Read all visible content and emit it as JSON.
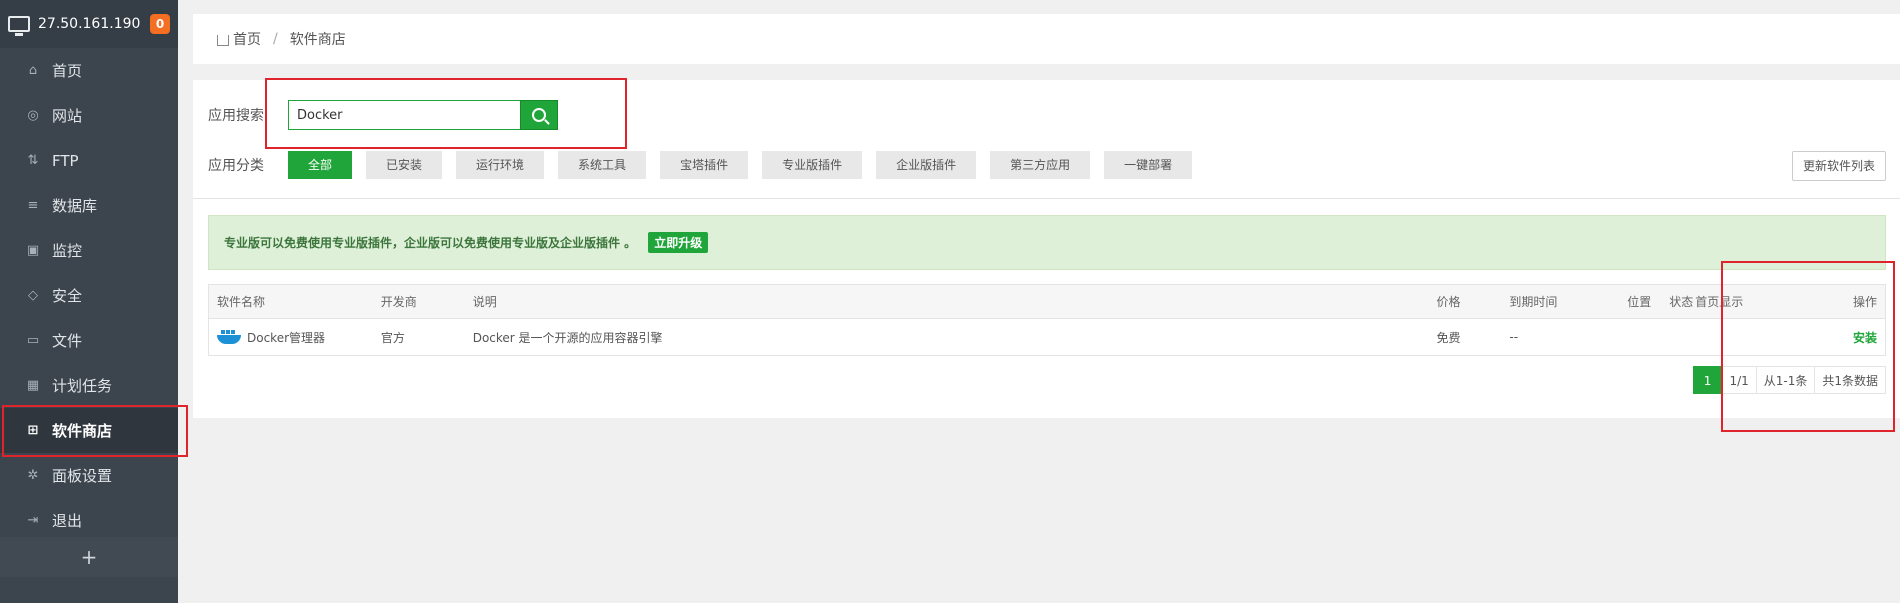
{
  "sidebar": {
    "server_ip": "27.50.161.190",
    "badge_count": "0",
    "items": [
      {
        "label": "首页",
        "icon": "home-icon"
      },
      {
        "label": "网站",
        "icon": "globe-icon"
      },
      {
        "label": "FTP",
        "icon": "ftp-icon"
      },
      {
        "label": "数据库",
        "icon": "database-icon"
      },
      {
        "label": "监控",
        "icon": "monitor-icon"
      },
      {
        "label": "安全",
        "icon": "shield-icon"
      },
      {
        "label": "文件",
        "icon": "folder-icon"
      },
      {
        "label": "计划任务",
        "icon": "calendar-icon"
      },
      {
        "label": "软件商店",
        "icon": "grid-icon"
      },
      {
        "label": "面板设置",
        "icon": "gear-icon"
      },
      {
        "label": "退出",
        "icon": "logout-icon"
      }
    ],
    "add_label": "+"
  },
  "breadcrumb": {
    "home": "首页",
    "separator": "/",
    "current": "软件商店"
  },
  "search": {
    "label": "应用搜索",
    "value": "Docker"
  },
  "categories": {
    "label": "应用分类",
    "items": [
      "全部",
      "已安装",
      "运行环境",
      "系统工具",
      "宝塔插件",
      "专业版插件",
      "企业版插件",
      "第三方应用",
      "一键部署"
    ]
  },
  "refresh_label": "更新软件列表",
  "notice": {
    "text": "专业版可以免费使用专业版插件，企业版可以免费使用专业版及企业版插件 。",
    "upgrade_label": "立即升级"
  },
  "table": {
    "headers": [
      "软件名称",
      "开发商",
      "说明",
      "价格",
      "到期时间",
      "位置",
      "状态",
      "首页显示",
      "操作"
    ],
    "rows": [
      {
        "name": "Docker管理器",
        "developer": "官方",
        "description": "Docker 是一个开源的应用容器引擎",
        "price": "免费",
        "expire": "--",
        "position": "",
        "status": "",
        "homepage": "",
        "action": "安装"
      }
    ]
  },
  "pager": {
    "current": "1",
    "pages": "1/1",
    "range": "从1-1条",
    "total": "共1条数据"
  },
  "colors": {
    "accent": "#20a53a",
    "sidebar_bg": "#3c444d",
    "highlight": "#e0242b"
  }
}
